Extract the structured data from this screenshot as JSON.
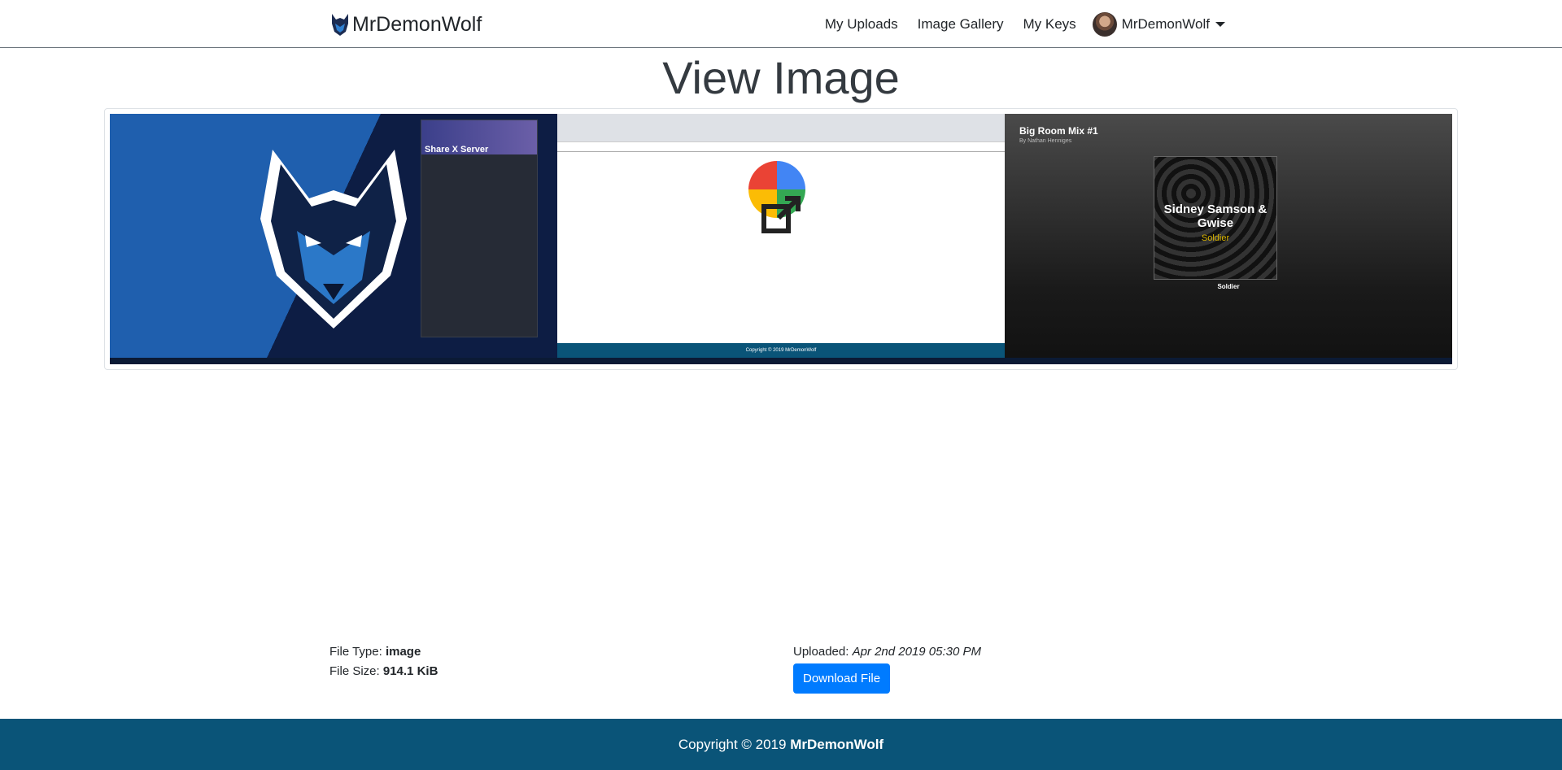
{
  "nav": {
    "brand": "MrDemonWolf",
    "links": [
      "My Uploads",
      "Image Gallery",
      "My Keys"
    ],
    "user": "MrDemonWolf"
  },
  "page": {
    "title": "View Image"
  },
  "preview": {
    "left_panel_title": "Share X Server",
    "middle_footer": "Copyright © 2019 MrDemonWolf",
    "right_mix_title": "Big Room Mix #1",
    "right_mix_by": "By Nathan Henniges",
    "album_artist": "Sidney Samson & Gwise",
    "album_song": "Soldier"
  },
  "info": {
    "file_type_label": "File Type:",
    "file_type": "image",
    "file_size_label": "File Size:",
    "file_size": "914.1 KiB",
    "uploaded_label": "Uploaded:",
    "uploaded": "Apr 2nd 2019 05:30 PM",
    "download_label": "Download File"
  },
  "footer": {
    "copyright": "Copyright © 2019",
    "brand": "MrDemonWolf"
  }
}
